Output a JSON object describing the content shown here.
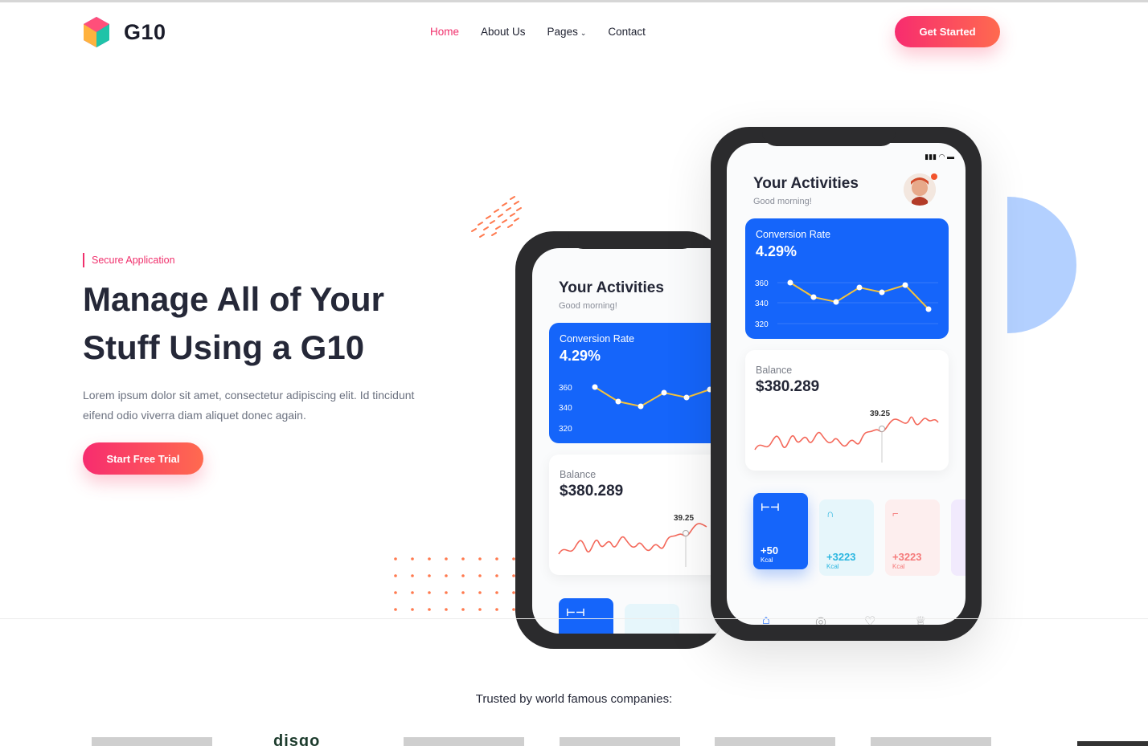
{
  "header": {
    "brand": "G10",
    "nav": [
      {
        "label": "Home",
        "active": true
      },
      {
        "label": "About Us"
      },
      {
        "label": "Pages"
      },
      {
        "label": "Contact"
      }
    ],
    "cta": "Get Started"
  },
  "hero": {
    "eyebrow": "Secure Application",
    "title_line1": "Manage All of Your",
    "title_line2": "Stuff Using a G10",
    "description_line1": "Lorem ipsum dolor sit amet, consectetur adipiscing elit. Id tincidunt",
    "description_line2": "eifend odio viverra diam aliquet donec again.",
    "cta": "Start Free Trial"
  },
  "app": {
    "title": "Your Activities",
    "greeting": "Good morning!",
    "conversion_label": "Conversion Rate",
    "conversion_value": "4.29%",
    "conversion_axis": [
      "360",
      "340",
      "320"
    ],
    "balance_label": "Balance",
    "balance_value": "$380.289",
    "balance_marker": "39.25",
    "tiles": [
      {
        "value": "+50",
        "unit": "Kcal",
        "color": "#1565fa"
      },
      {
        "value": "+3223",
        "unit": "Kcal",
        "color": "#2bb6e0"
      },
      {
        "value": "+3223",
        "unit": "Kcal",
        "color": "#f57a7a"
      }
    ],
    "tab_icons": [
      "home-icon",
      "location-icon",
      "heart-icon",
      "trophy-icon"
    ]
  },
  "trusted": {
    "text": "Trusted by world famous companies:",
    "partial_logo": "disqo"
  },
  "colors": {
    "accent": "#f0306c",
    "blue": "#1565fa",
    "light_blue": "#b3d0ff"
  }
}
